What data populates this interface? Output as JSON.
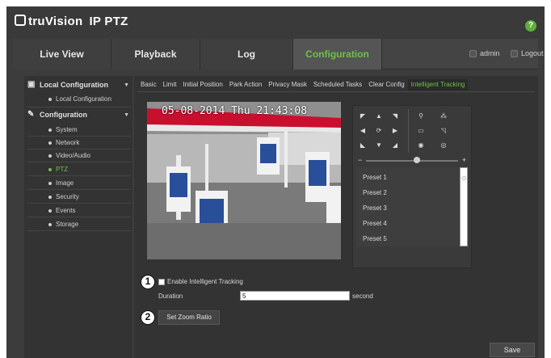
{
  "app": {
    "logo_brand": "truVision",
    "logo_model": "IP PTZ",
    "help_icon": "?"
  },
  "nav": {
    "tabs": [
      {
        "label": "Live View",
        "icon": "none"
      },
      {
        "label": "Playback"
      },
      {
        "label": "Log"
      },
      {
        "label": "Configuration",
        "active": true
      }
    ],
    "user": "admin",
    "logout": "Logout"
  },
  "sidebar": {
    "local_group": "Local Configuration",
    "local_items": [
      "Local Configuration"
    ],
    "config_group": "Configuration",
    "config_items": [
      "System",
      "Network",
      "Video/Audio",
      "PTZ",
      "Image",
      "Security",
      "Events",
      "Storage"
    ],
    "active_item": "PTZ"
  },
  "subtabs": [
    "Basic",
    "Limit",
    "Initial Position",
    "Park Action",
    "Privacy Mask",
    "Scheduled Tasks",
    "Clear Config",
    "Intelligent Tracking"
  ],
  "active_subtab": "Intelligent Tracking",
  "video": {
    "osd_date": "05-08-2014",
    "osd_day": "Thu",
    "osd_time": "21:43:08"
  },
  "ptz": {
    "presets": [
      "Preset 1",
      "Preset 2",
      "Preset 3",
      "Preset 4",
      "Preset 5"
    ],
    "speed_minus": "−",
    "speed_plus": "+",
    "speed_level": 0.55
  },
  "tracking": {
    "marker_1": "1",
    "marker_2": "2",
    "enable_label": "Enable Intelligent Tracking",
    "enable_checked": false,
    "duration_label": "Duration",
    "duration_value": "5",
    "duration_unit": "second",
    "zoom_button": "Set Zoom Ratio"
  },
  "save_button": "Save",
  "colors": {
    "accent_green": "#6fc146",
    "canopy_red": "#c8102e",
    "pump_blue": "#2a4f9a"
  }
}
